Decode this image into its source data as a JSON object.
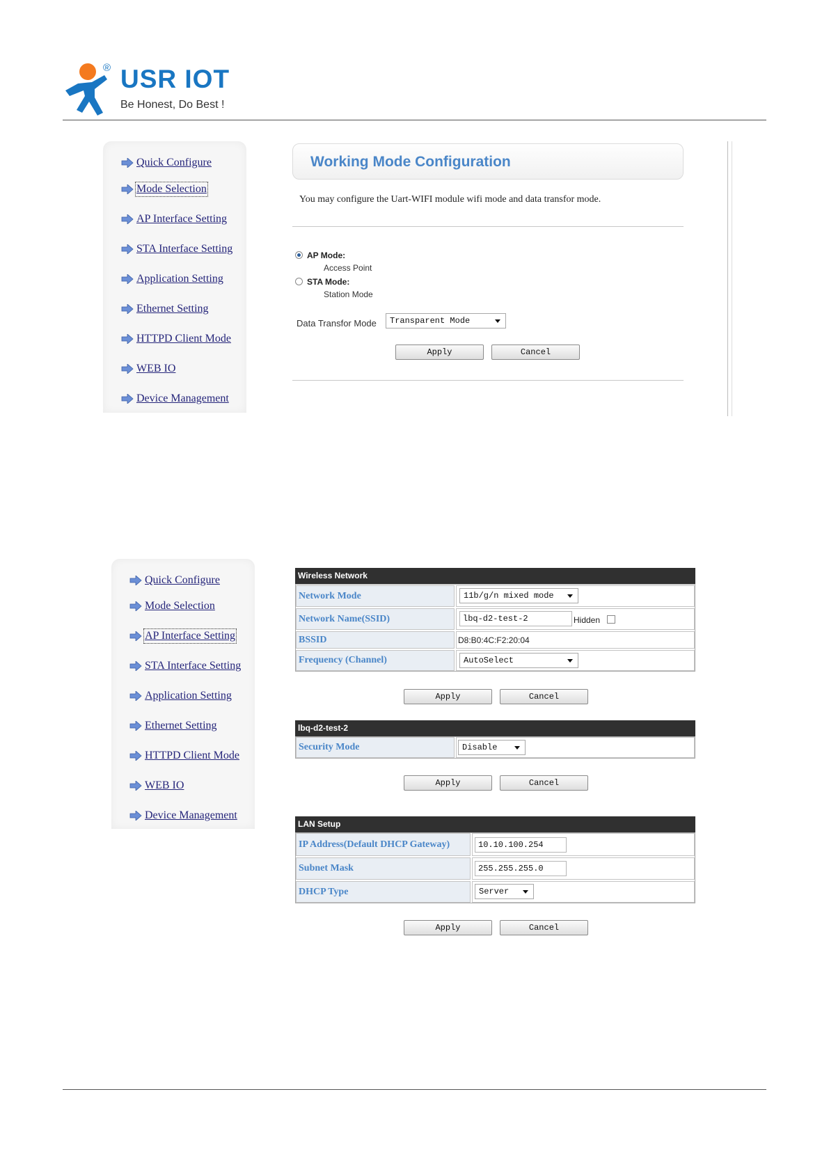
{
  "brand": {
    "name": "USR IOT",
    "registered": "®",
    "slogan": "Be Honest, Do Best !",
    "logo_colors": {
      "head": "#f47a1f",
      "body": "#1976c2"
    }
  },
  "sidebar": {
    "items": [
      {
        "label": "Quick Configure"
      },
      {
        "label": "Mode Selection"
      },
      {
        "label": "AP Interface Setting"
      },
      {
        "label": "STA Interface Setting"
      },
      {
        "label": "Application Setting"
      },
      {
        "label": "Ethernet Setting"
      },
      {
        "label": "HTTPD Client Mode"
      },
      {
        "label": "WEB IO"
      },
      {
        "label": "Device Management"
      }
    ],
    "selected_top": "Mode Selection",
    "selected_bottom": "AP Interface Setting"
  },
  "mode_page": {
    "title": "Working Mode Configuration",
    "description": "You may configure the Uart-WIFI module wifi mode and data transfor mode.",
    "ap_mode": {
      "label": "AP Mode:",
      "sub": "Access Point",
      "checked": true
    },
    "sta_mode": {
      "label": "STA Mode:",
      "sub": "Station Mode",
      "checked": false
    },
    "data_transfer": {
      "label": "Data Transfor Mode",
      "value": "Transparent Mode"
    },
    "apply": "Apply",
    "cancel": "Cancel"
  },
  "wireless": {
    "header": "Wireless Network",
    "rows": {
      "network_mode": {
        "label": "Network Mode",
        "value": "11b/g/n mixed mode"
      },
      "ssid": {
        "label": "Network Name(SSID)",
        "value": "lbq-d2-test-2",
        "hidden_label": "Hidden"
      },
      "bssid": {
        "label": "BSSID",
        "value": "D8:B0:4C:F2:20:04"
      },
      "frequency": {
        "label": "Frequency (Channel)",
        "value": "AutoSelect"
      }
    },
    "apply": "Apply",
    "cancel": "Cancel"
  },
  "security": {
    "header": "lbq-d2-test-2",
    "mode": {
      "label": "Security Mode",
      "value": "Disable"
    },
    "apply": "Apply",
    "cancel": "Cancel"
  },
  "lan": {
    "header": "LAN Setup",
    "ip": {
      "label": "IP Address(Default DHCP Gateway)",
      "value": "10.10.100.254"
    },
    "mask": {
      "label": "Subnet Mask",
      "value": "255.255.255.0"
    },
    "dhcp": {
      "label": "DHCP Type",
      "value": "Server"
    },
    "apply": "Apply",
    "cancel": "Cancel"
  }
}
